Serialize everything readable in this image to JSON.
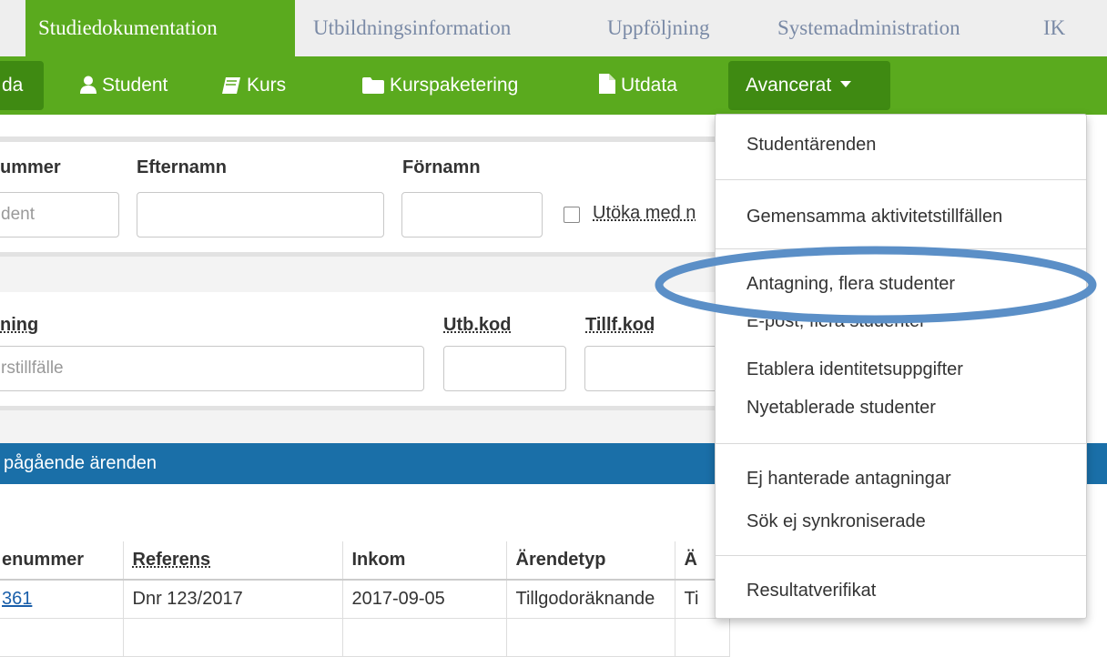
{
  "top_tabs": [
    "Studiedokumentation",
    "Utbildningsinformation",
    "Uppföljning",
    "Systemadministration",
    "IK"
  ],
  "nav": {
    "cut_item": "da",
    "student": "Student",
    "kurs": "Kurs",
    "kurspaketering": "Kurspaketering",
    "utdata": "Utdata",
    "avancerat": "Avancerat"
  },
  "search_student": {
    "labels": {
      "nummer": "ummer",
      "efternamn": "Efternamn",
      "fornamn": "Förnamn"
    },
    "nummer_placeholder": "dent",
    "efternamn_value": "",
    "fornamn_value": "",
    "checkbox_label": "Utöka med n"
  },
  "search_course": {
    "labels": {
      "benamning": "ning",
      "utbkod": "Utb.kod",
      "tillfkod": "Tillf.kod"
    },
    "benamning_placeholder": "rstillfälle",
    "utbkod_value": "",
    "tillfkod_value": ""
  },
  "cases_bar": "pågående ärenden",
  "table": {
    "headers": [
      "enummer",
      "Referens",
      "Inkom",
      "Ärendetyp",
      "Ä"
    ],
    "rows": [
      [
        "361",
        "Dnr 123/2017",
        "2017-09-05",
        "Tillgodoräknande",
        "Ti"
      ]
    ]
  },
  "dropdown": {
    "groups": [
      [
        "Studentärenden"
      ],
      [
        "Gemensamma aktivitetstillfällen"
      ],
      [
        "Antagning, flera studenter",
        "E-post, flera studenter",
        "Etablera identitetsuppgifter",
        "Nyetablerade studenter"
      ],
      [
        "Ej hanterade antagningar",
        "Sök ej synkroniserade"
      ],
      [
        "Resultatverifikat"
      ]
    ]
  },
  "colors": {
    "green": "#5aaa1e",
    "dark_green": "#3f8a12",
    "blue": "#1a6fa8",
    "highlight": "#5b8fc7"
  }
}
